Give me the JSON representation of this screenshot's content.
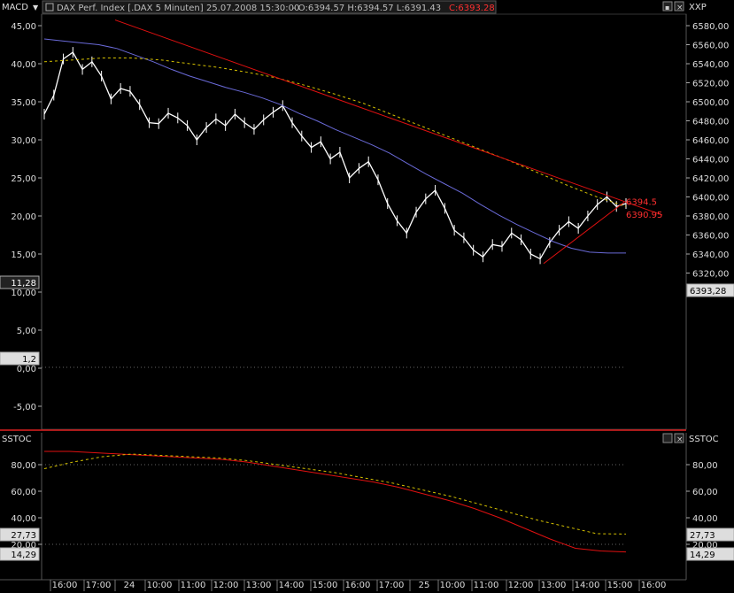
{
  "upper_panel": {
    "left_indicator": "MACD",
    "header": {
      "instrument": "DAX Perf. Index [.DAX  5 Minuten]",
      "datetime": "25.07.2008 15:30:00",
      "ohl": "- O:6394.57 H:6394.57 L:6391.43",
      "close": "C:6393.28"
    },
    "right_indicator": "XXP",
    "left_axis_ticks": [
      "45,00",
      "40,00",
      "35,00",
      "30,00",
      "25,00",
      "20,00",
      "15,00",
      "10,00",
      "5,00",
      "0,00",
      "-5,00"
    ],
    "right_axis_ticks": [
      "6580,00",
      "6560,00",
      "6540,00",
      "6520,00",
      "6500,00",
      "6480,00",
      "6460,00",
      "6440,00",
      "6420,00",
      "6400,00",
      "6380,00",
      "6360,00",
      "6340,00",
      "6320,00"
    ],
    "left_markers": [
      "11,28",
      "1,2"
    ],
    "right_marker": "6393,28",
    "annotations": [
      "6394.5",
      "6390.95"
    ]
  },
  "lower_panel": {
    "left_indicator": "SSTOC",
    "right_indicator": "SSTOC",
    "axis_ticks": [
      "80,00",
      "60,00",
      "40,00",
      "20,00"
    ],
    "left_markers": [
      "27,73",
      "14,29"
    ],
    "right_markers": [
      "27,73",
      "14,29"
    ]
  },
  "time_axis_labels": [
    "16:00",
    "17:00",
    "24",
    "10:00",
    "11:00",
    "12:00",
    "13:00",
    "14:00",
    "15:00",
    "16:00",
    "17:00",
    "25",
    "10:00",
    "11:00",
    "12:00",
    "13:00",
    "14:00",
    "15:00",
    "16:00"
  ],
  "colors": {
    "price": "#ffffff",
    "trendline": "#e01010",
    "slow_ma": "#d4c000",
    "fast_ma": "#6a6ad8",
    "stoch_k": "#e01010",
    "stoch_d": "#d4c000",
    "close_text": "#ff3030"
  },
  "chart_data": {
    "type": "line",
    "title": "DAX Perf. Index [.DAX  5 Minuten]",
    "x": [
      "16:00",
      "17:00",
      "24",
      "10:00",
      "11:00",
      "12:00",
      "13:00",
      "14:00",
      "15:00",
      "16:00",
      "17:00",
      "25",
      "10:00",
      "11:00",
      "12:00",
      "13:00",
      "14:00",
      "15:00"
    ],
    "price_axis": {
      "ylim": [
        6310,
        6590
      ],
      "grid": false,
      "side": "right"
    },
    "macd_axis": {
      "ylim": [
        -7,
        47
      ],
      "side": "left"
    },
    "series": [
      {
        "name": "DAX close",
        "values": [
          6487,
          6507,
          6545,
          6552,
          6534,
          6542,
          6527,
          6503,
          6514,
          6511,
          6497,
          6478,
          6477,
          6488,
          6483,
          6475,
          6460,
          6473,
          6482,
          6475,
          6487,
          6478,
          6471,
          6481,
          6489,
          6496,
          6478,
          6464,
          6452,
          6458,
          6440,
          6447,
          6420,
          6430,
          6437,
          6418,
          6393,
          6375,
          6362,
          6384,
          6398,
          6407,
          6388,
          6365,
          6357,
          6344,
          6337,
          6350,
          6348,
          6362,
          6355,
          6340,
          6335,
          6352,
          6365,
          6374,
          6367,
          6380,
          6392,
          6400,
          6390,
          6393
        ]
      },
      {
        "name": "",
        "values": [
          6566,
          6564,
          6562,
          6560,
          6556,
          6549,
          6542,
          6534,
          6527,
          6521,
          6515,
          6510,
          6504,
          6497,
          6488,
          6480,
          6471,
          6463,
          6455,
          6446,
          6435,
          6424,
          6414,
          6404,
          6392,
          6381,
          6371,
          6362,
          6353,
          6346,
          6342,
          6341,
          6341
        ]
      },
      {
        "name": "",
        "values": [
          6542,
          6544,
          6546,
          6546,
          6544,
          6540,
          6536,
          6531,
          6525,
          6517,
          6508,
          6498,
          6486,
          6474,
          6462,
          6450,
          6438,
          6425,
          6412,
          6400,
          6390
        ]
      }
    ],
    "trendlines": [
      {
        "from": [
          "17:00 (23.07)",
          6586
        ],
        "to": [
          "16:00 (25.07)",
          6381
        ]
      },
      {
        "from": [
          "13:00 (25.07)",
          6330
        ],
        "to": [
          "15:00 (25.07)",
          6394.5
        ]
      }
    ],
    "stochastic": {
      "ylim": [
        0,
        100
      ],
      "series": [
        {
          "name": "",
          "values": [
            90,
            90,
            89,
            88,
            87,
            86,
            85,
            84,
            82,
            79,
            76,
            73,
            70,
            67,
            63,
            58,
            53,
            47,
            40,
            32,
            24,
            17,
            15,
            14.29
          ]
        },
        {
          "name": "",
          "values": [
            77,
            82,
            86,
            88,
            87,
            86,
            85,
            83,
            80,
            77,
            74,
            70,
            66,
            61,
            56,
            50,
            44,
            38,
            33,
            28,
            27.73
          ]
        }
      ]
    }
  }
}
